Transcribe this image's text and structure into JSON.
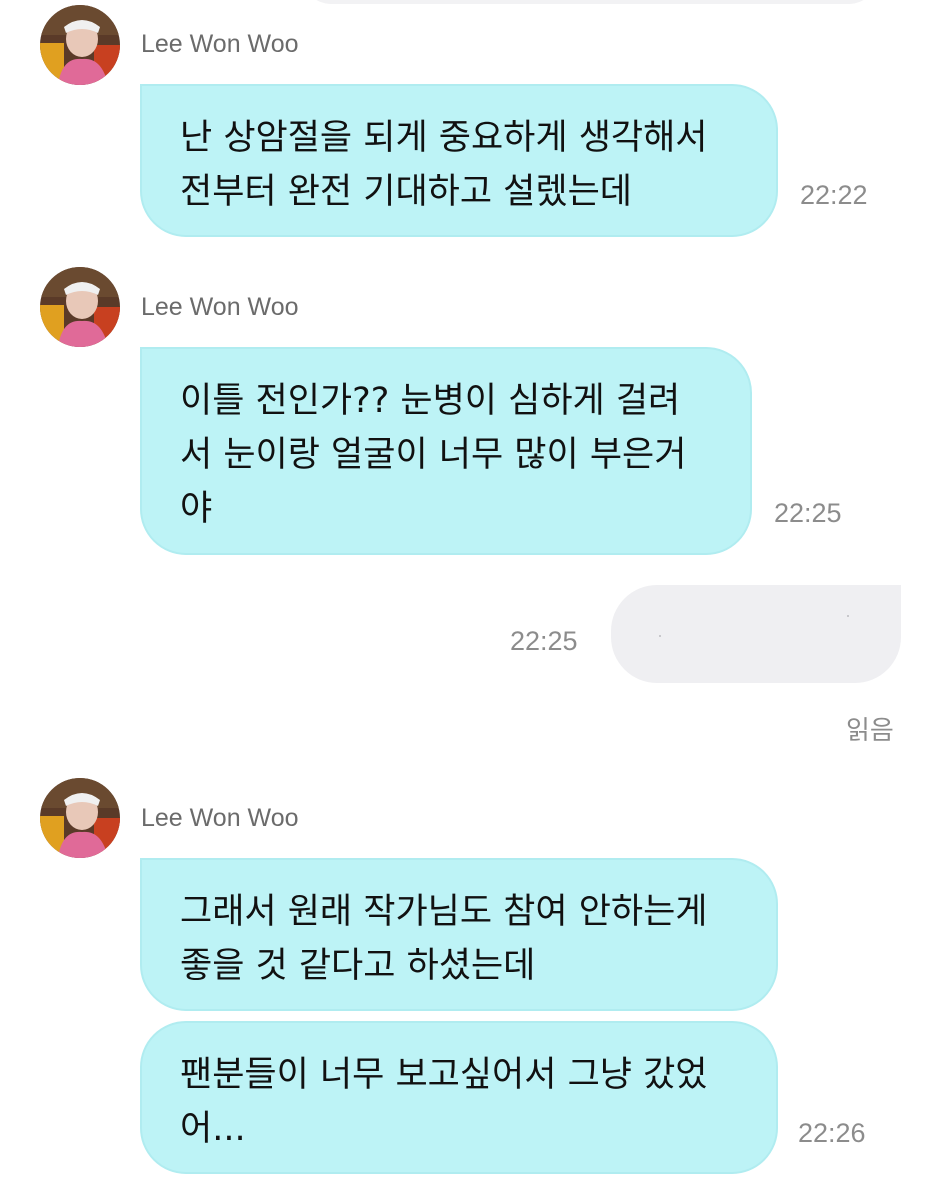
{
  "conversation": {
    "groups": [
      {
        "sender": "Lee Won Woo",
        "messages": [
          {
            "lines": [
              "난 상암절을 되게 중요하게 생각해서",
              "전부터 완전 기대하고 설렜는데"
            ],
            "time": "22:22"
          }
        ]
      },
      {
        "sender": "Lee Won Woo",
        "messages": [
          {
            "lines": [
              "이틀 전인가?? 눈병이 심하게 걸려",
              "서 눈이랑 얼굴이 너무 많이 부은거",
              "야"
            ],
            "time": "22:25"
          }
        ]
      },
      {
        "sender": "Lee Won Woo",
        "messages": [
          {
            "lines": [
              "그래서 원래 작가님도 참여 안하는게",
              "좋을 것 같다고 하셨는데"
            ],
            "time": ""
          },
          {
            "lines": [
              "팬분들이 너무 보고싶어서 그냥 갔었",
              "어..."
            ],
            "time": "22:26"
          }
        ]
      }
    ],
    "my_message": {
      "time": "22:25",
      "read_status": "읽음"
    }
  },
  "colors": {
    "incoming_bubble": "#bdf3f6",
    "outgoing_bubble": "#efeff2",
    "muted_text": "#8c8c8c"
  }
}
